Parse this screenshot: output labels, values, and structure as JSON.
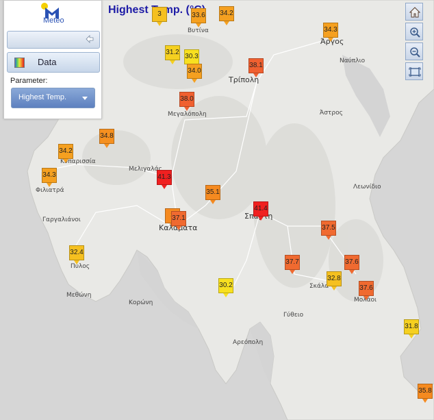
{
  "title": "Highest Temp. (°C)",
  "logo_text": "Meteo",
  "panel": {
    "data_label": "Data",
    "parameter_label": "Parameter:",
    "parameter_value": "Highest Temp."
  },
  "places": [
    {
      "name": "Βυτίνα",
      "big": false
    },
    {
      "name": "Άργος",
      "big": true
    },
    {
      "name": "Ναύπλιο",
      "big": false
    },
    {
      "name": "Τρίπολη",
      "big": true
    },
    {
      "name": "Μεγαλόπολη",
      "big": false
    },
    {
      "name": "Άστρος",
      "big": false
    },
    {
      "name": "Κυπαρισσία",
      "big": false
    },
    {
      "name": "Μελιγαλάς",
      "big": false
    },
    {
      "name": "Φιλιατρά",
      "big": false
    },
    {
      "name": "Λεωνίδιο",
      "big": false
    },
    {
      "name": "Γαργαλιάνοι",
      "big": false
    },
    {
      "name": "Καλαμάτα",
      "big": true
    },
    {
      "name": "Σπάρτη",
      "big": true
    },
    {
      "name": "Πύλος",
      "big": false
    },
    {
      "name": "Σκάλα",
      "big": false
    },
    {
      "name": "Μολάοι",
      "big": false
    },
    {
      "name": "Μεθώνη",
      "big": false
    },
    {
      "name": "Κορώνη",
      "big": false
    },
    {
      "name": "Γύθειο",
      "big": false
    },
    {
      "name": "Αρεόπολη",
      "big": false
    }
  ],
  "markers": [
    {
      "value": "3",
      "color": "#f5c020"
    },
    {
      "value": "33.6",
      "color": "#f5a020"
    },
    {
      "value": "34.2",
      "color": "#f5a020"
    },
    {
      "value": "34.3",
      "color": "#f5a020"
    },
    {
      "value": "31.2",
      "color": "#f5d020"
    },
    {
      "value": "30.3",
      "color": "#f8e020"
    },
    {
      "value": "34.0",
      "color": "#f5a020"
    },
    {
      "value": "38.1",
      "color": "#f06030"
    },
    {
      "value": "38.0",
      "color": "#f06030"
    },
    {
      "value": "34.8",
      "color": "#f59020"
    },
    {
      "value": "34.2",
      "color": "#f5a020"
    },
    {
      "value": "34.3",
      "color": "#f5a020"
    },
    {
      "value": "41.3",
      "color": "#f02020"
    },
    {
      "value": "35.1",
      "color": "#f58a20"
    },
    {
      "value": "41.4",
      "color": "#f02020"
    },
    {
      "value": "3",
      "color": "#f58a20"
    },
    {
      "value": "37.1",
      "color": "#f06a30"
    },
    {
      "value": "37.5",
      "color": "#f06a30"
    },
    {
      "value": "32.4",
      "color": "#f5c020"
    },
    {
      "value": "37.7",
      "color": "#f06a30"
    },
    {
      "value": "37.6",
      "color": "#f06a30"
    },
    {
      "value": "32.8",
      "color": "#f5c020"
    },
    {
      "value": "30.2",
      "color": "#f8e020"
    },
    {
      "value": "37.6",
      "color": "#f06a30"
    },
    {
      "value": "31.8",
      "color": "#f5d020"
    },
    {
      "value": "35.8",
      "color": "#f58a20"
    }
  ],
  "controls": [
    {
      "name": "home-icon"
    },
    {
      "name": "zoom-in-icon"
    },
    {
      "name": "zoom-out-icon"
    },
    {
      "name": "full-extent-icon"
    }
  ]
}
